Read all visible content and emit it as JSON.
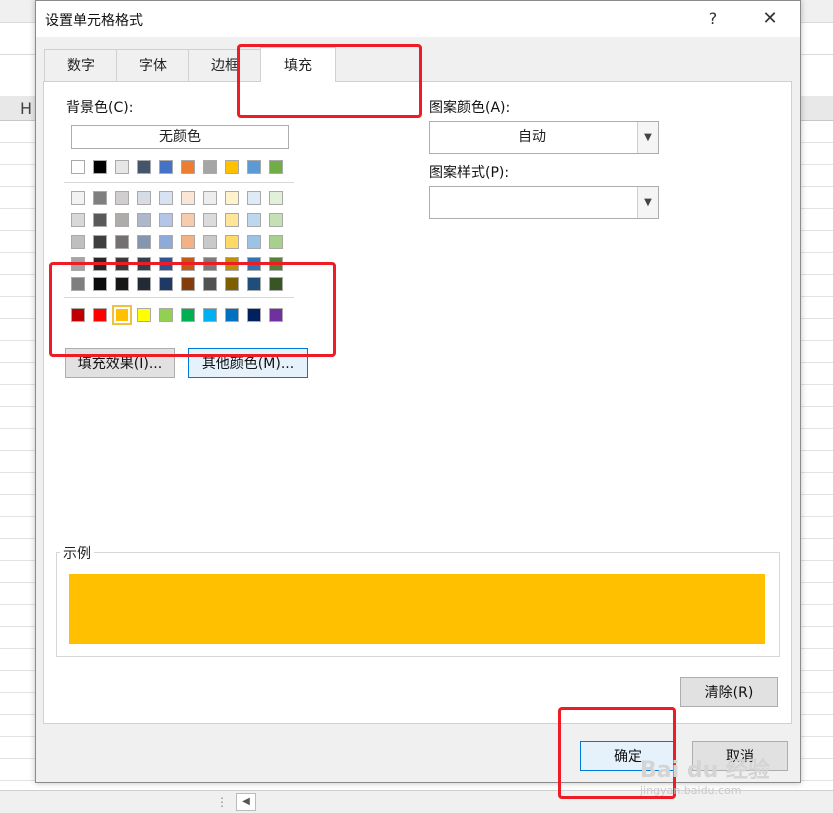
{
  "background": {
    "column_header": "H"
  },
  "dialog": {
    "title": "设置单元格格式",
    "help_label": "?",
    "close_label": "✕"
  },
  "tabs": [
    {
      "label": "数字"
    },
    {
      "label": "字体"
    },
    {
      "label": "边框"
    },
    {
      "label": "填充",
      "active": true
    }
  ],
  "fill": {
    "background_color_label": "背景色(C):",
    "no_color_label": "无颜色",
    "theme_colors": [
      [
        "#ffffff",
        "#000000",
        "#e7e6e6",
        "#44546a",
        "#4472c4",
        "#ed7d31",
        "#a5a5a5",
        "#ffc000",
        "#5b9bd5",
        "#70ad47"
      ],
      [
        "#f2f2f2",
        "#7f7f7f",
        "#d0cece",
        "#d6dce4",
        "#d9e2f3",
        "#fbe5d5",
        "#ededed",
        "#fff2cc",
        "#deebf6",
        "#e2efd9"
      ],
      [
        "#d8d8d8",
        "#595959",
        "#aeabab",
        "#adb9ca",
        "#b4c6e7",
        "#f7cbac",
        "#dbdbdb",
        "#fee599",
        "#bdd7ee",
        "#c5e0b3"
      ],
      [
        "#bfbfbf",
        "#3f3f3f",
        "#757070",
        "#8496b0",
        "#8eaadb",
        "#f4b183",
        "#c9c9c9",
        "#ffd965",
        "#9cc3e5",
        "#a8d08d"
      ],
      [
        "#a5a5a5",
        "#262626",
        "#3a3838",
        "#323f4f",
        "#2f5496",
        "#c45911",
        "#7b7b7b",
        "#bf9000",
        "#2e75b5",
        "#538135"
      ],
      [
        "#7f7f7f",
        "#0c0c0c",
        "#171616",
        "#222a35",
        "#1f3864",
        "#833c0b",
        "#525252",
        "#7f6000",
        "#1e4e79",
        "#375623"
      ]
    ],
    "standard_colors": [
      "#c00000",
      "#ff0000",
      "#ffc000",
      "#ffff00",
      "#92d050",
      "#00b050",
      "#00b0f0",
      "#0070c0",
      "#002060",
      "#7030a0"
    ],
    "selected_color": "#ffc000",
    "fill_effects_label": "填充效果(I)...",
    "more_colors_label": "其他颜色(M)...",
    "pattern_color_label": "图案颜色(A):",
    "pattern_color_value": "自动",
    "pattern_style_label": "图案样式(P):",
    "pattern_style_value": "",
    "sample_label": "示例",
    "clear_label": "清除(R)"
  },
  "footer": {
    "ok_label": "确定",
    "cancel_label": "取消"
  },
  "watermark": {
    "brand": "Bai du 经验",
    "url": "jingyan.baidu.com"
  },
  "annotation_color": "#ee1c24"
}
